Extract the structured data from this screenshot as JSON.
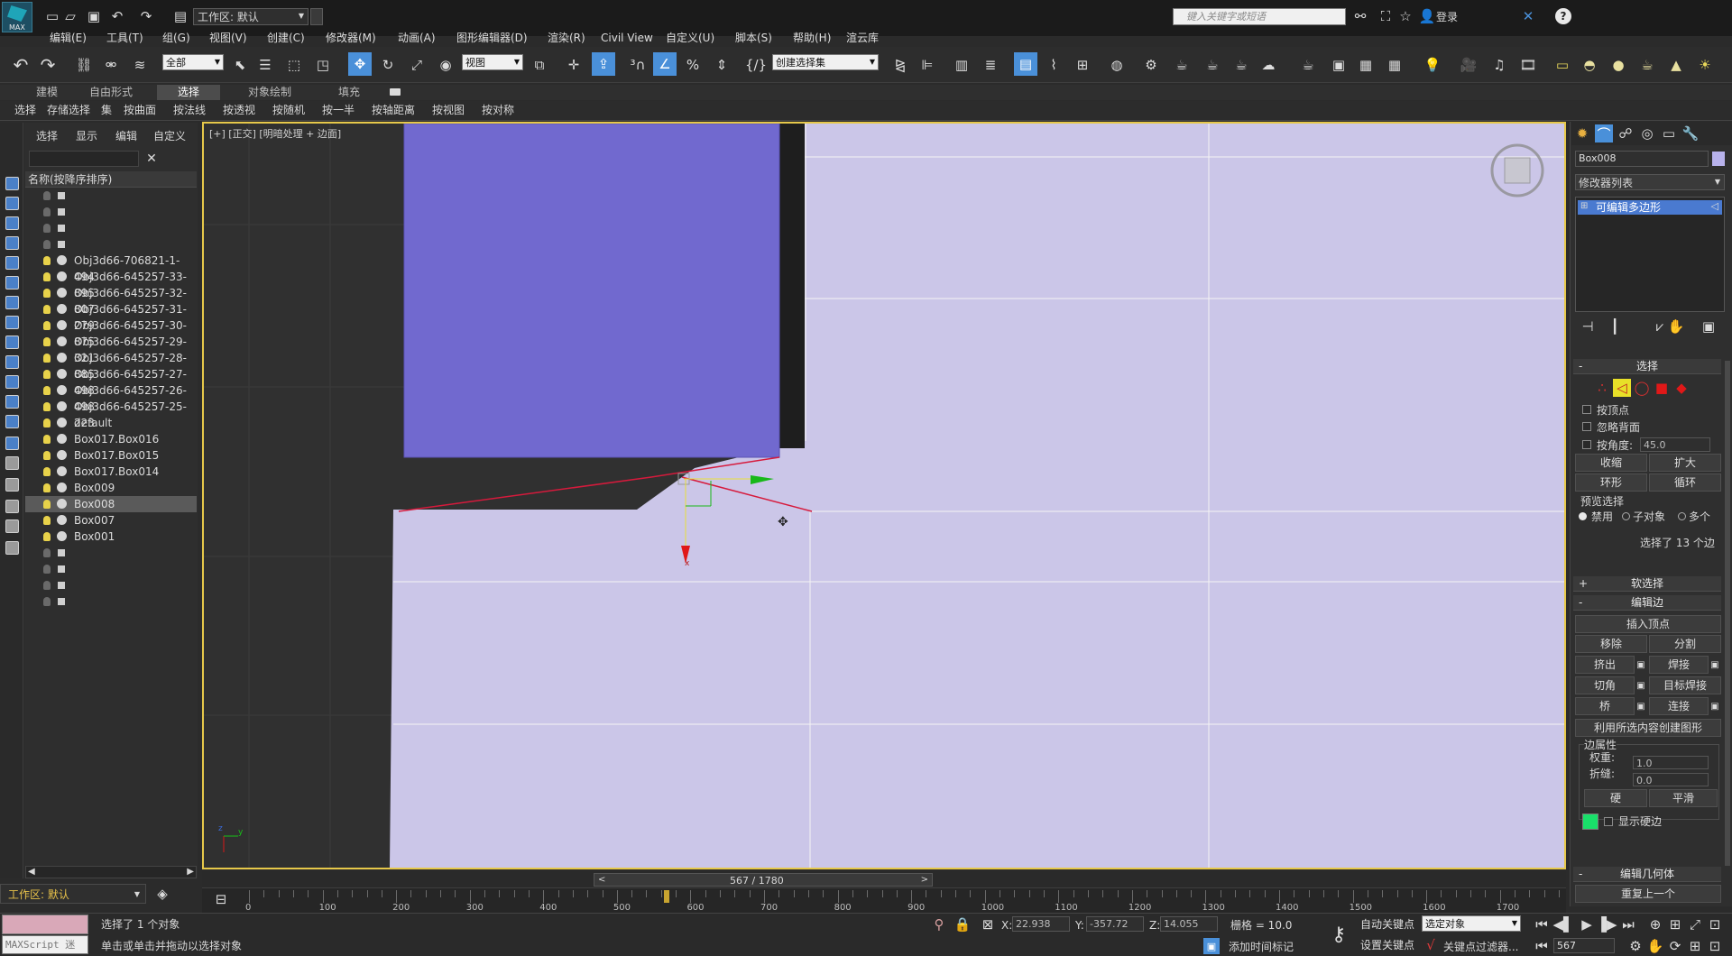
{
  "app": {
    "logo_text": "MAX",
    "workspace_label": "工作区: 默认"
  },
  "search": {
    "placeholder": "键入关键字或短语",
    "login": "登录"
  },
  "menu": [
    "编辑(E)",
    "工具(T)",
    "组(G)",
    "视图(V)",
    "创建(C)",
    "修改器(M)",
    "动画(A)",
    "图形编辑器(D)",
    "渲染(R)",
    "Civil View",
    "自定义(U)",
    "脚本(S)",
    "帮助(H)",
    "渲云库"
  ],
  "toolbar": {
    "filter": "全部",
    "ref_coord": "视图",
    "selection_set": "创建选择集"
  },
  "ribbon_tabs": [
    "建模",
    "自由形式",
    "选择",
    "对象绘制",
    "填充"
  ],
  "ribbon_active": "选择",
  "sub_tabs": [
    "选择",
    "存储选择",
    "集",
    "按曲面",
    "按法线",
    "按透视",
    "按随机",
    "按一半",
    "按轴距离",
    "按视图",
    "按对称"
  ],
  "scene_explorer": {
    "tabs": [
      "选择",
      "显示",
      "编辑",
      "自定义"
    ],
    "column_header": "名称(按降序排序)",
    "objects": [
      {
        "name": "",
        "kind": "layer",
        "lit": false
      },
      {
        "name": "",
        "kind": "layer",
        "lit": false
      },
      {
        "name": "",
        "kind": "layer",
        "lit": false
      },
      {
        "name": "",
        "kind": "layer",
        "lit": false
      },
      {
        "name": "Obj3d66-706821-1-494",
        "kind": "obj",
        "lit": true
      },
      {
        "name": "Obj3d66-645257-33-895",
        "kind": "obj",
        "lit": true
      },
      {
        "name": "Obj3d66-645257-32-807",
        "kind": "obj",
        "lit": true
      },
      {
        "name": "Obj3d66-645257-31-279",
        "kind": "obj",
        "lit": true
      },
      {
        "name": "Obj3d66-645257-30-875",
        "kind": "obj",
        "lit": true
      },
      {
        "name": "Obj3d66-645257-29-321",
        "kind": "obj",
        "lit": true
      },
      {
        "name": "Obj3d66-645257-28-885",
        "kind": "obj",
        "lit": true
      },
      {
        "name": "Obj3d66-645257-27-498",
        "kind": "obj",
        "lit": true
      },
      {
        "name": "Obj3d66-645257-26-498",
        "kind": "obj",
        "lit": true
      },
      {
        "name": "Obj3d66-645257-25-223",
        "kind": "obj",
        "lit": true
      },
      {
        "name": "default",
        "kind": "obj",
        "lit": true
      },
      {
        "name": "Box017.Box016",
        "kind": "obj",
        "lit": true
      },
      {
        "name": "Box017.Box015",
        "kind": "obj",
        "lit": true
      },
      {
        "name": "Box017.Box014",
        "kind": "obj",
        "lit": true
      },
      {
        "name": "Box009",
        "kind": "obj",
        "lit": true
      },
      {
        "name": "Box008",
        "kind": "obj",
        "lit": true,
        "selected": true
      },
      {
        "name": "Box007",
        "kind": "obj",
        "lit": true
      },
      {
        "name": "Box001",
        "kind": "obj",
        "lit": true
      },
      {
        "name": "",
        "kind": "layer",
        "lit": false
      },
      {
        "name": "",
        "kind": "layer",
        "lit": false
      },
      {
        "name": "",
        "kind": "layer",
        "lit": false
      },
      {
        "name": "",
        "kind": "layer",
        "lit": false
      }
    ],
    "workspace_footer": "工作区: 默认"
  },
  "viewport": {
    "label": "[+] [正交] [明暗处理 + 边面]",
    "mesh_color": "#cbc6e8",
    "box_color": "#7169cf",
    "edge_color": "#d61a3c",
    "gizmo_x": "#ff2020",
    "gizmo_y": "#1cc41c",
    "axis_label_z": "z",
    "axis_label_y": "y",
    "axis_label_x": "x"
  },
  "command_panel": {
    "object_name": "Box008",
    "modifier_list": "修改器列表",
    "stack_item": "可编辑多边形",
    "selection_title": "选择",
    "by_vertex": "按顶点",
    "ignore_backface": "忽略背面",
    "by_angle": "按角度:",
    "angle_value": "45.0",
    "shrink": "收缩",
    "grow": "扩大",
    "ring": "环形",
    "loop": "循环",
    "preview_title": "预览选择",
    "preview_options": [
      "禁用",
      "子对象",
      "多个"
    ],
    "selected_info": "选择了 13 个边",
    "soft_selection": "软选择",
    "edit_edges": "编辑边",
    "insert_vertex": "插入顶点",
    "remove": "移除",
    "split": "分割",
    "extrude": "挤出",
    "weld": "焊接",
    "chamfer": "切角",
    "target_weld": "目标焊接",
    "bridge": "桥",
    "connect": "连接",
    "create_shape": "利用所选内容创建图形",
    "edge_props": "边属性",
    "weight_label": "权重:",
    "weight_value": "1.0",
    "crease_label": "折缝:",
    "crease_value": "0.0",
    "hard": "硬",
    "smooth": "平滑",
    "show_hard_edges": "显示硬边",
    "edit_geometry": "编辑几何体",
    "repeat_last": "重复上一个"
  },
  "timeline": {
    "frame_label": "567 / 1780",
    "current_frame": 567,
    "total_frames": 1780,
    "ticks": [
      "0",
      "100",
      "200",
      "300",
      "400",
      "500",
      "600",
      "700",
      "800",
      "900",
      "1000",
      "1100",
      "1200",
      "1300",
      "1400",
      "1500",
      "1600",
      "1700"
    ]
  },
  "status": {
    "maxscript": "MAXScript 迷",
    "line1": "选择了 1 个对象",
    "line2": "单击或单击并拖动以选择对象",
    "x_label": "X:",
    "x_value": "22.938",
    "y_label": "Y:",
    "y_value": "-357.72",
    "z_label": "Z:",
    "z_value": "14.055",
    "grid": "栅格 = 10.0",
    "add_time_tag": "添加时间标记",
    "auto_key": "自动关键点",
    "set_key": "设置关键点",
    "key_dropdown": "选定对象",
    "key_filters": "关键点过滤器...",
    "frame_field": "567"
  },
  "colors": {
    "accent": "#4a90d9",
    "selected_row": "#5a5a5a",
    "hard_edge_swatch": "#19e06a"
  }
}
